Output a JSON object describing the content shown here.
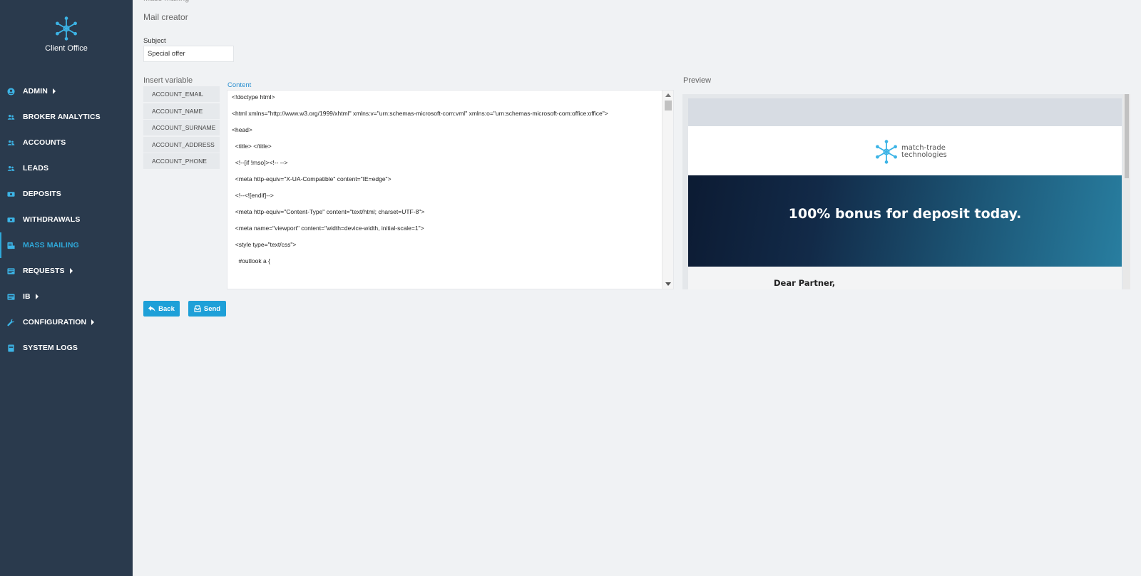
{
  "brand": {
    "name": "Client Office"
  },
  "nav": [
    {
      "label": "ADMIN",
      "icon": "user-circle-icon",
      "caret": true,
      "active": false
    },
    {
      "label": "BROKER ANALYTICS",
      "icon": "users-icon",
      "caret": false,
      "active": false
    },
    {
      "label": "ACCOUNTS",
      "icon": "users-icon",
      "caret": false,
      "active": false
    },
    {
      "label": "LEADS",
      "icon": "users-icon",
      "caret": false,
      "active": false
    },
    {
      "label": "DEPOSITS",
      "icon": "money-icon",
      "caret": false,
      "active": false
    },
    {
      "label": "WITHDRAWALS",
      "icon": "money-icon",
      "caret": false,
      "active": false
    },
    {
      "label": "MASS MAILING",
      "icon": "mailing-icon",
      "caret": false,
      "active": true
    },
    {
      "label": "REQUESTS",
      "icon": "list-icon",
      "caret": true,
      "active": false
    },
    {
      "label": "IB",
      "icon": "list-icon",
      "caret": true,
      "active": false
    },
    {
      "label": "CONFIGURATION",
      "icon": "wrench-icon",
      "caret": true,
      "active": false
    },
    {
      "label": "SYSTEM LOGS",
      "icon": "book-icon",
      "caret": false,
      "active": false
    }
  ],
  "page": {
    "title": "Mail creator"
  },
  "subject": {
    "label": "Subject",
    "value": "Special offer"
  },
  "variables": {
    "title": "Insert variable",
    "items": [
      "ACCOUNT_EMAIL",
      "ACCOUNT_NAME",
      "ACCOUNT_SURNAME",
      "ACCOUNT_ADDRESS",
      "ACCOUNT_PHONE"
    ]
  },
  "content": {
    "label": "Content",
    "lines": [
      "<!doctype html>",
      "<html xmlns=\"http://www.w3.org/1999/xhtml\" xmlns:v=\"urn:schemas-microsoft-com:vml\" xmlns:o=\"urn:schemas-microsoft-com:office:office\">",
      "",
      "<head>",
      "  <title> </title>",
      "  <!--[if !mso]><!-- -->",
      "  <meta http-equiv=\"X-UA-Compatible\" content=\"IE=edge\">",
      "  <!--<![endif]-->",
      "  <meta http-equiv=\"Content-Type\" content=\"text/html; charset=UTF-8\">",
      "  <meta name=\"viewport\" content=\"width=device-width, initial-scale=1\">",
      "  <style type=\"text/css\">",
      "    #outlook a {"
    ]
  },
  "preview": {
    "title": "Preview",
    "logo_line1": "match-trade",
    "logo_line2": "technologies",
    "banner": "100% bonus for deposit today.",
    "greeting": "Dear Partner,"
  },
  "actions": {
    "back": "Back",
    "send": "Send"
  },
  "colors": {
    "sidebar": "#2a3a4d",
    "accent": "#1ea0d8",
    "active_nav": "#2fa8d9"
  }
}
